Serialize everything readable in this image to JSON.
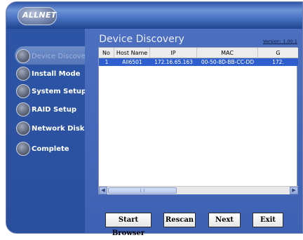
{
  "brand": {
    "logo_text": "ALLNET"
  },
  "sidebar": {
    "items": [
      {
        "label": "Device Discovery",
        "active": true
      },
      {
        "label": "Install Mode",
        "active": false
      },
      {
        "label": "System Setup",
        "active": false
      },
      {
        "label": "RAID Setup",
        "active": false
      },
      {
        "label": "Network Disk",
        "active": false
      },
      {
        "label": "Complete",
        "active": false
      }
    ]
  },
  "main": {
    "title": "Device Discovery",
    "version": "Version: 1.00.1"
  },
  "table": {
    "columns": [
      "No",
      "Host Name",
      "IP",
      "MAC",
      "G"
    ],
    "rows": [
      {
        "no": "1",
        "host": "All6501",
        "ip": "172.16.65.163",
        "mac": "00-50-8D-BB-CC-DD",
        "gw": "172."
      }
    ]
  },
  "buttons": {
    "start_browser": "Start Browser",
    "rescan": "Rescan",
    "next": "Next",
    "exit": "Exit"
  },
  "colors": {
    "background": "#3b63b6",
    "selected_row": "#2f5fcf",
    "active_nav": "#6d8cc8"
  }
}
